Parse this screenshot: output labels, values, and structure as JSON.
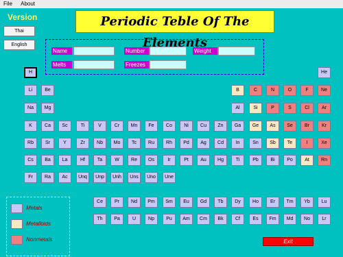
{
  "menu": {
    "file": "File",
    "about": "About"
  },
  "version_label": "Version",
  "lang_buttons": {
    "thai": "Thai",
    "english": "English"
  },
  "title": "Periodic Teble Of The  Elements",
  "fields": {
    "name": "Name",
    "number": "Number",
    "weight": "Weight",
    "melts": "Melts",
    "freezes": "Freezes"
  },
  "legend": {
    "metals": "Metals",
    "metalloids": "Metalloids",
    "nonmetals": "Nonmetals"
  },
  "exit_label": "Exit",
  "colors": {
    "background": "#00c0c0",
    "metal": "#c8c8f8",
    "metalloid": "#f8e8c4",
    "nonmetal": "#f08080",
    "title_bg": "#ffff33",
    "field_label": "#cc00cc",
    "exit": "#ff0000"
  },
  "elements": [
    {
      "s": "H",
      "t": "metal",
      "r": 1,
      "c": 1,
      "sel": true
    },
    {
      "s": "He",
      "t": "metal",
      "r": 1,
      "c": 18
    },
    {
      "s": "Li",
      "t": "metal",
      "r": 2,
      "c": 1
    },
    {
      "s": "Be",
      "t": "metal",
      "r": 2,
      "c": 2
    },
    {
      "s": "B",
      "t": "metalloid",
      "r": 2,
      "c": 13
    },
    {
      "s": "C",
      "t": "nonmetal",
      "r": 2,
      "c": 14
    },
    {
      "s": "N",
      "t": "nonmetal",
      "r": 2,
      "c": 15
    },
    {
      "s": "O",
      "t": "nonmetal",
      "r": 2,
      "c": 16
    },
    {
      "s": "F",
      "t": "nonmetal",
      "r": 2,
      "c": 17
    },
    {
      "s": "Ne",
      "t": "nonmetal",
      "r": 2,
      "c": 18
    },
    {
      "s": "Na",
      "t": "metal",
      "r": 3,
      "c": 1
    },
    {
      "s": "Mg",
      "t": "metal",
      "r": 3,
      "c": 2
    },
    {
      "s": "Al",
      "t": "metal",
      "r": 3,
      "c": 13
    },
    {
      "s": "Si",
      "t": "metalloid",
      "r": 3,
      "c": 14
    },
    {
      "s": "P",
      "t": "nonmetal",
      "r": 3,
      "c": 15
    },
    {
      "s": "S",
      "t": "nonmetal",
      "r": 3,
      "c": 16
    },
    {
      "s": "Cl",
      "t": "nonmetal",
      "r": 3,
      "c": 17
    },
    {
      "s": "Ar",
      "t": "nonmetal",
      "r": 3,
      "c": 18
    },
    {
      "s": "K",
      "t": "metal",
      "r": 4,
      "c": 1
    },
    {
      "s": "Ca",
      "t": "metal",
      "r": 4,
      "c": 2
    },
    {
      "s": "Sc",
      "t": "metal",
      "r": 4,
      "c": 3
    },
    {
      "s": "Ti",
      "t": "metal",
      "r": 4,
      "c": 4
    },
    {
      "s": "V",
      "t": "metal",
      "r": 4,
      "c": 5
    },
    {
      "s": "Cr",
      "t": "metal",
      "r": 4,
      "c": 6
    },
    {
      "s": "Mn",
      "t": "metal",
      "r": 4,
      "c": 7
    },
    {
      "s": "Fe",
      "t": "metal",
      "r": 4,
      "c": 8
    },
    {
      "s": "Co",
      "t": "metal",
      "r": 4,
      "c": 9
    },
    {
      "s": "Ni",
      "t": "metal",
      "r": 4,
      "c": 10
    },
    {
      "s": "Cu",
      "t": "metal",
      "r": 4,
      "c": 11
    },
    {
      "s": "Zn",
      "t": "metal",
      "r": 4,
      "c": 12
    },
    {
      "s": "Ga",
      "t": "metal",
      "r": 4,
      "c": 13
    },
    {
      "s": "Ge",
      "t": "metalloid",
      "r": 4,
      "c": 14
    },
    {
      "s": "As",
      "t": "metalloid",
      "r": 4,
      "c": 15
    },
    {
      "s": "Se",
      "t": "nonmetal",
      "r": 4,
      "c": 16
    },
    {
      "s": "Br",
      "t": "nonmetal",
      "r": 4,
      "c": 17
    },
    {
      "s": "Kr",
      "t": "nonmetal",
      "r": 4,
      "c": 18
    },
    {
      "s": "Rb",
      "t": "metal",
      "r": 5,
      "c": 1
    },
    {
      "s": "Sr",
      "t": "metal",
      "r": 5,
      "c": 2
    },
    {
      "s": "Y",
      "t": "metal",
      "r": 5,
      "c": 3
    },
    {
      "s": "Zr",
      "t": "metal",
      "r": 5,
      "c": 4
    },
    {
      "s": "Nb",
      "t": "metal",
      "r": 5,
      "c": 5
    },
    {
      "s": "Mo",
      "t": "metal",
      "r": 5,
      "c": 6
    },
    {
      "s": "Tc",
      "t": "metal",
      "r": 5,
      "c": 7
    },
    {
      "s": "Ru",
      "t": "metal",
      "r": 5,
      "c": 8
    },
    {
      "s": "Rh",
      "t": "metal",
      "r": 5,
      "c": 9
    },
    {
      "s": "Pd",
      "t": "metal",
      "r": 5,
      "c": 10
    },
    {
      "s": "Ag",
      "t": "metal",
      "r": 5,
      "c": 11
    },
    {
      "s": "Cd",
      "t": "metal",
      "r": 5,
      "c": 12
    },
    {
      "s": "In",
      "t": "metal",
      "r": 5,
      "c": 13
    },
    {
      "s": "Sn",
      "t": "metal",
      "r": 5,
      "c": 14
    },
    {
      "s": "Sb",
      "t": "metalloid",
      "r": 5,
      "c": 15
    },
    {
      "s": "Te",
      "t": "metalloid",
      "r": 5,
      "c": 16
    },
    {
      "s": "I",
      "t": "nonmetal",
      "r": 5,
      "c": 17
    },
    {
      "s": "Xe",
      "t": "nonmetal",
      "r": 5,
      "c": 18
    },
    {
      "s": "Cs",
      "t": "metal",
      "r": 6,
      "c": 1
    },
    {
      "s": "Ba",
      "t": "metal",
      "r": 6,
      "c": 2
    },
    {
      "s": "La",
      "t": "metal",
      "r": 6,
      "c": 3
    },
    {
      "s": "Hf",
      "t": "metal",
      "r": 6,
      "c": 4
    },
    {
      "s": "Ta",
      "t": "metal",
      "r": 6,
      "c": 5
    },
    {
      "s": "W",
      "t": "metal",
      "r": 6,
      "c": 6
    },
    {
      "s": "Re",
      "t": "metal",
      "r": 6,
      "c": 7
    },
    {
      "s": "Os",
      "t": "metal",
      "r": 6,
      "c": 8
    },
    {
      "s": "Ir",
      "t": "metal",
      "r": 6,
      "c": 9
    },
    {
      "s": "Pt",
      "t": "metal",
      "r": 6,
      "c": 10
    },
    {
      "s": "Au",
      "t": "metal",
      "r": 6,
      "c": 11
    },
    {
      "s": "Hg",
      "t": "metal",
      "r": 6,
      "c": 12
    },
    {
      "s": "Ti",
      "t": "metal",
      "r": 6,
      "c": 13
    },
    {
      "s": "Pb",
      "t": "metal",
      "r": 6,
      "c": 14
    },
    {
      "s": "Bi",
      "t": "metal",
      "r": 6,
      "c": 15
    },
    {
      "s": "Po",
      "t": "metal",
      "r": 6,
      "c": 16
    },
    {
      "s": "At",
      "t": "metalloid",
      "r": 6,
      "c": 17
    },
    {
      "s": "Rn",
      "t": "nonmetal",
      "r": 6,
      "c": 18
    },
    {
      "s": "Fr",
      "t": "metal",
      "r": 7,
      "c": 1
    },
    {
      "s": "Ra",
      "t": "metal",
      "r": 7,
      "c": 2
    },
    {
      "s": "Ac",
      "t": "metal",
      "r": 7,
      "c": 3
    },
    {
      "s": "Unq",
      "t": "metal",
      "r": 7,
      "c": 4
    },
    {
      "s": "Unp",
      "t": "metal",
      "r": 7,
      "c": 5
    },
    {
      "s": "Unh",
      "t": "metal",
      "r": 7,
      "c": 6
    },
    {
      "s": "Uns",
      "t": "metal",
      "r": 7,
      "c": 7
    },
    {
      "s": "Uno",
      "t": "metal",
      "r": 7,
      "c": 8
    },
    {
      "s": "Une",
      "t": "metal",
      "r": 7,
      "c": 9
    },
    {
      "s": "Ce",
      "t": "metal",
      "r": 9,
      "c": 5
    },
    {
      "s": "Pr",
      "t": "metal",
      "r": 9,
      "c": 6
    },
    {
      "s": "Nd",
      "t": "metal",
      "r": 9,
      "c": 7
    },
    {
      "s": "Pm",
      "t": "metal",
      "r": 9,
      "c": 8
    },
    {
      "s": "Sm",
      "t": "metal",
      "r": 9,
      "c": 9
    },
    {
      "s": "Eu",
      "t": "metal",
      "r": 9,
      "c": 10
    },
    {
      "s": "Gd",
      "t": "metal",
      "r": 9,
      "c": 11
    },
    {
      "s": "Tb",
      "t": "metal",
      "r": 9,
      "c": 12
    },
    {
      "s": "Dy",
      "t": "metal",
      "r": 9,
      "c": 13
    },
    {
      "s": "Ho",
      "t": "metal",
      "r": 9,
      "c": 14
    },
    {
      "s": "Er",
      "t": "metal",
      "r": 9,
      "c": 15
    },
    {
      "s": "Tm",
      "t": "metal",
      "r": 9,
      "c": 16
    },
    {
      "s": "Yb",
      "t": "metal",
      "r": 9,
      "c": 17
    },
    {
      "s": "Lu",
      "t": "metal",
      "r": 9,
      "c": 18
    },
    {
      "s": "Th",
      "t": "metal",
      "r": 10,
      "c": 5
    },
    {
      "s": "Pa",
      "t": "metal",
      "r": 10,
      "c": 6
    },
    {
      "s": "U",
      "t": "metal",
      "r": 10,
      "c": 7
    },
    {
      "s": "Np",
      "t": "metal",
      "r": 10,
      "c": 8
    },
    {
      "s": "Pu",
      "t": "metal",
      "r": 10,
      "c": 9
    },
    {
      "s": "Am",
      "t": "metal",
      "r": 10,
      "c": 10
    },
    {
      "s": "Cm",
      "t": "metal",
      "r": 10,
      "c": 11
    },
    {
      "s": "Bk",
      "t": "metal",
      "r": 10,
      "c": 12
    },
    {
      "s": "Cf",
      "t": "metal",
      "r": 10,
      "c": 13
    },
    {
      "s": "Es",
      "t": "metal",
      "r": 10,
      "c": 14
    },
    {
      "s": "Fm",
      "t": "metal",
      "r": 10,
      "c": 15
    },
    {
      "s": "Md",
      "t": "metal",
      "r": 10,
      "c": 16
    },
    {
      "s": "No",
      "t": "metal",
      "r": 10,
      "c": 17
    },
    {
      "s": "Lr",
      "t": "metal",
      "r": 10,
      "c": 18
    }
  ]
}
